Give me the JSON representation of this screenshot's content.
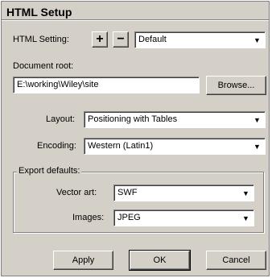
{
  "window": {
    "title": "HTML Setup"
  },
  "html_setting": {
    "label": "HTML Setting:",
    "add_icon": "+",
    "remove_icon": "−",
    "selected": "Default"
  },
  "document_root": {
    "label": "Document root:",
    "value": "E:\\working\\Wiley\\site",
    "browse_label": "Browse..."
  },
  "layout": {
    "label": "Layout:",
    "selected": "Positioning with Tables"
  },
  "encoding": {
    "label": "Encoding:",
    "selected": "Western (Latin1)"
  },
  "export_defaults": {
    "label": "Export defaults:",
    "vector_art": {
      "label": "Vector art:",
      "selected": "SWF"
    },
    "images": {
      "label": "Images:",
      "selected": "JPEG"
    }
  },
  "buttons": {
    "apply": "Apply",
    "ok": "OK",
    "cancel": "Cancel"
  },
  "icons": {
    "dropdown": "chevron-down-icon",
    "add": "plus-icon",
    "remove": "minus-icon"
  }
}
